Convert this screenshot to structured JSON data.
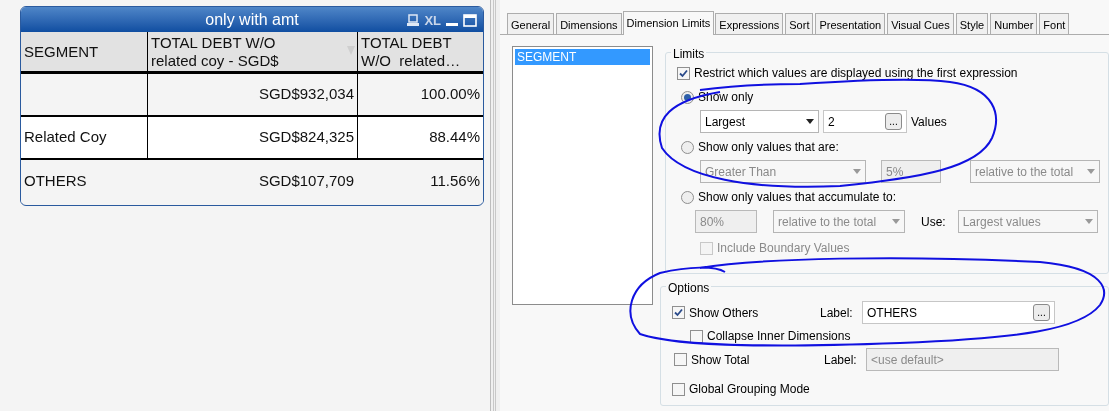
{
  "chart_box": {
    "title": "only with amt",
    "caption_icons": [
      "XL"
    ],
    "columns": [
      {
        "lines": [
          "SEGMENT"
        ]
      },
      {
        "lines": [
          "TOTAL DEBT W/O",
          "related coy - SGD$"
        ]
      },
      {
        "lines": [
          "TOTAL DEBT",
          "W/O  related…"
        ]
      }
    ],
    "rows": [
      {
        "amount": "SGD$932,034",
        "percent": "100.00%"
      },
      {
        "segment": "Related Coy",
        "amount": "SGD$824,325",
        "percent": "88.44%"
      },
      {
        "segment": "OTHERS",
        "amount": "SGD$107,709",
        "percent": "11.56%"
      }
    ]
  },
  "dialog": {
    "tabs": [
      {
        "label": "General",
        "selected": false
      },
      {
        "label": "Dimensions",
        "selected": false
      },
      {
        "label": "Dimension Limits",
        "selected": true
      },
      {
        "label": "Expressions",
        "selected": false
      },
      {
        "label": "Sort",
        "selected": false
      },
      {
        "label": "Presentation",
        "selected": false
      },
      {
        "label": "Visual Cues",
        "selected": false
      },
      {
        "label": "Style",
        "selected": false
      },
      {
        "label": "Number",
        "selected": false
      },
      {
        "label": "Font",
        "selected": false
      }
    ],
    "dimension_list": [
      {
        "label": "SEGMENT",
        "selected": true
      }
    ],
    "limits": {
      "legend": "Limits",
      "restrict": {
        "label": "Restrict which values are displayed using the first expression",
        "checked": true
      },
      "show_only": {
        "label": "Show only",
        "selected": true,
        "mode": "Largest",
        "count": "2",
        "browse_button": "...",
        "suffix": "Values",
        "disabled": false
      },
      "show_only_values": {
        "label": "Show only values that are:",
        "selected": false,
        "comparison": "Greater Than",
        "amount": "5%",
        "relative": "relative to the total",
        "disabled": true
      },
      "accumulate": {
        "label": "Show only values that accumulate to:",
        "selected": false,
        "amount": "80%",
        "relative": "relative to the total",
        "use_label": "Use:",
        "use": "Largest values",
        "disabled": true
      },
      "include_boundary": {
        "label": "Include Boundary Values",
        "checked": false,
        "disabled": true
      }
    },
    "options": {
      "legend": "Options",
      "show_others": {
        "label": "Show Others",
        "checked": true,
        "label_caption": "Label:",
        "value": "OTHERS",
        "browse_button": "...",
        "disabled": false
      },
      "collapse_inner": {
        "label": "Collapse Inner Dimensions",
        "checked": false
      },
      "show_total": {
        "label": "Show Total",
        "checked": false,
        "label_caption": "Label:",
        "placeholder": "<use default>",
        "disabled": true
      },
      "global_grouping": {
        "label": "Global Grouping Mode",
        "checked": false
      }
    }
  }
}
